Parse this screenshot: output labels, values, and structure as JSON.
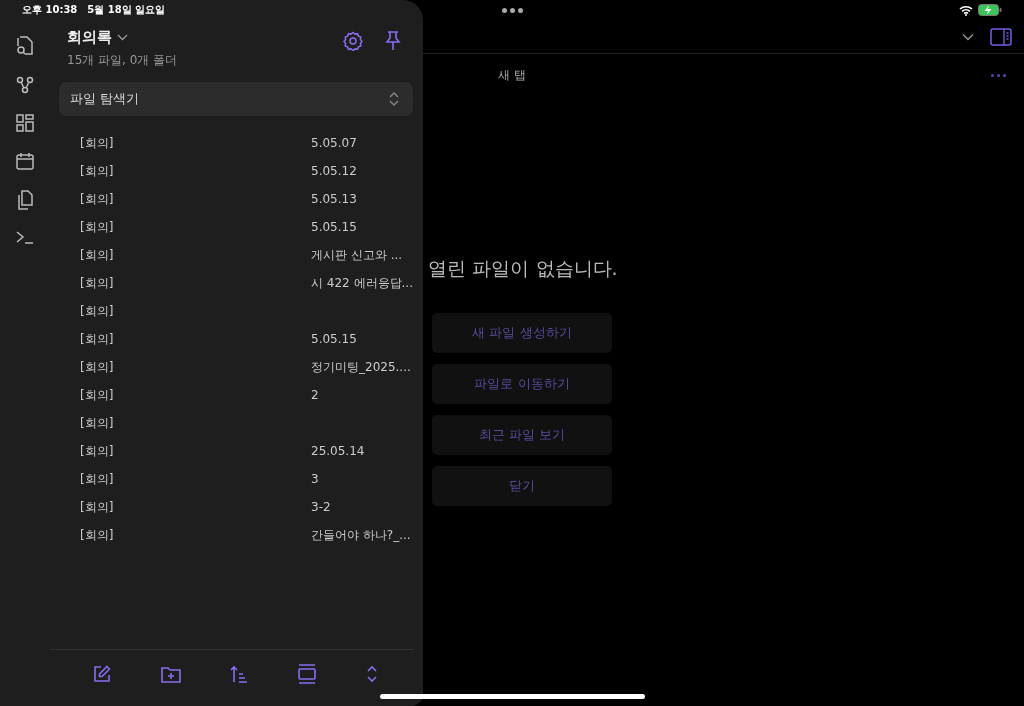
{
  "status_bar": {
    "time": "오후 10:38",
    "date": "5월 18일 일요일"
  },
  "main": {
    "tab": {
      "label": "새 탭",
      "selected": true
    },
    "empty_message": "열린 파일이 없습니다.",
    "actions": [
      "새 파일 생성하기",
      "파일로 이동하기",
      "최근 파일 보기",
      "닫기"
    ]
  },
  "sidebar": {
    "vault": "회의록",
    "counts": "15개 파일, 0개 폴더",
    "view_select": "파일 탐색기",
    "files": [
      {
        "prefix": "[회의]",
        "tail": "5.05.07"
      },
      {
        "prefix": "[회의]",
        "tail": "5.05.12"
      },
      {
        "prefix": "[회의]",
        "tail": "5.05.13"
      },
      {
        "prefix": "[회의]",
        "tail": "5.05.15"
      },
      {
        "prefix": "[회의]",
        "tail": "게시판 신고와 ..."
      },
      {
        "prefix": "[회의]",
        "tail": "시 422 에러응답..."
      },
      {
        "prefix": "[회의]"
      },
      {
        "prefix": "[회의]",
        "tail": "5.05.15"
      },
      {
        "prefix": "[회의]",
        "tail": "정기미팅_2025...."
      },
      {
        "prefix": "[회의]",
        "tail": "2"
      },
      {
        "prefix": "[회의]"
      },
      {
        "prefix": "[회의]",
        "tail": "25.05.14"
      },
      {
        "prefix": "[회의]",
        "tail": "3"
      },
      {
        "prefix": "[회의]",
        "tail": "3-2"
      },
      {
        "prefix": "[회의]",
        "tail": "간들어야 하나?_..."
      }
    ]
  }
}
